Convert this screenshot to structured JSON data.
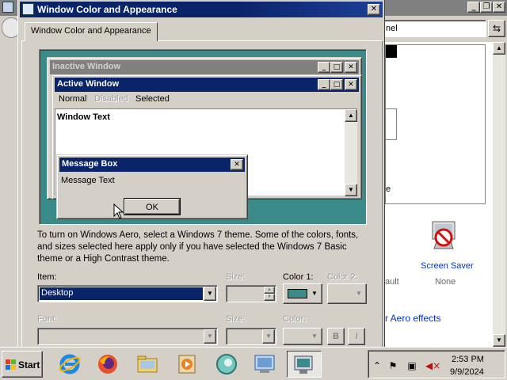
{
  "dialog": {
    "title": "Window Color and Appearance",
    "tab_label": "Window Color and Appearance",
    "preview": {
      "inactive_title": "Inactive Window",
      "active_title": "Active Window",
      "menu_normal": "Normal",
      "menu_disabled": "Disabled",
      "menu_selected": "Selected",
      "window_text": "Window Text",
      "message_box_title": "Message Box",
      "message_text": "Message Text",
      "ok_label": "OK",
      "desktop_color": "#3a8a8a"
    },
    "description": "To turn on Windows Aero, select a Windows 7 theme.  Some of the colors, fonts, and sizes selected here apply only if you have selected the Windows 7 Basic theme or a High Contrast theme.",
    "item_label": "Item:",
    "item_value": "Desktop",
    "size_label": "Size:",
    "color1_label": "Color 1:",
    "color2_label": "Color 2:",
    "font_label": "Font:",
    "font_size_label": "Size:",
    "font_color_label": "Color:",
    "bold_label": "B",
    "italic_label": "I"
  },
  "background_window": {
    "address_text": "nel",
    "screen_saver_label": "Screen Saver",
    "screen_saver_value": "None",
    "ault_text": "ault",
    "e_text": "e",
    "aero_link": "r Aero effects"
  },
  "taskbar": {
    "start_label": "Start",
    "icons": [
      "internet-explorer-icon",
      "firefox-icon",
      "file-explorer-icon",
      "media-player-icon",
      "app-icon",
      "control-panel-icon",
      "display-settings-icon"
    ],
    "clock_time": "2:53 PM",
    "clock_date": "9/9/2024"
  }
}
